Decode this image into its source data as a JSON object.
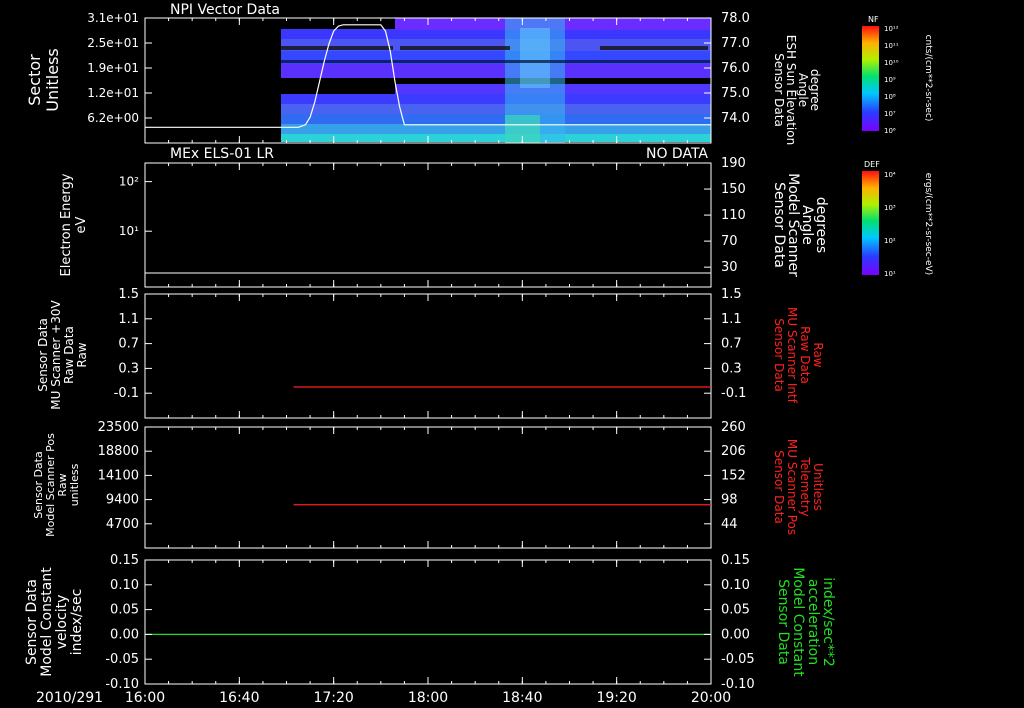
{
  "colors": {
    "background": "#000000",
    "axes": "#ffffff",
    "red_trace": "#ff2020",
    "green_trace": "#22dd22"
  },
  "chart_data": [
    {
      "type": "heatmap",
      "title": "NPI Vector Data",
      "ylabel": [
        "Sector",
        "Unitless"
      ],
      "yticks": [
        "3.1e+01",
        "2.5e+01",
        "1.9e+01",
        "1.2e+01",
        "6.2e+00"
      ],
      "y2label": [
        "Sensor Data",
        "ESH Sun Elevation",
        "Angle",
        "degree"
      ],
      "y2ticks": [
        "78.0",
        "77.0",
        "76.0",
        "75.0",
        "74.0"
      ],
      "y2lim": [
        73.3,
        78.0
      ],
      "overlay_line": {
        "x_minutes": [
          0,
          65,
          68,
          70,
          72,
          74,
          76,
          78,
          80,
          82,
          84,
          100,
          102,
          104,
          106,
          108,
          110,
          240
        ],
        "y": [
          73.8,
          73.8,
          73.9,
          74.2,
          74.8,
          75.6,
          76.4,
          77.1,
          77.6,
          77.8,
          77.85,
          77.85,
          77.6,
          76.8,
          75.6,
          74.6,
          73.9,
          73.9
        ]
      },
      "colorbar": {
        "label": "NF",
        "unit": "cnts/(cm**2-sr-sec)",
        "ticks": [
          "10¹²",
          "10¹¹",
          "10¹⁰",
          "10⁹",
          "10⁸",
          "10⁷",
          "10⁶"
        ]
      }
    },
    {
      "type": "line",
      "title": "MEx ELS-01 LR",
      "status": "NO DATA",
      "ylabel": [
        "Electron Energy",
        "eV"
      ],
      "yticks": [
        "10²",
        "10¹"
      ],
      "y2label": [
        "Sensor Data",
        "Model Scanner",
        "Angle",
        "degrees"
      ],
      "y2ticks": [
        "190",
        "150",
        "110",
        "70",
        "30"
      ],
      "y2lim": [
        0,
        190
      ],
      "series": [
        {
          "x_minutes": [
            0,
            240
          ],
          "y": [
            10,
            10
          ]
        }
      ],
      "colorbar": {
        "label": "DEF",
        "unit": "ergs/(cm**2-sr-sec-eV)",
        "ticks": [
          "10⁴",
          "10³",
          "10²",
          "10¹"
        ]
      }
    },
    {
      "type": "line",
      "ylabel": [
        "Sensor Data",
        "MU Scanner +30V",
        "Raw Data",
        "Raw"
      ],
      "yticks": [
        "1.5",
        "1.1",
        "0.7",
        "0.3",
        "-0.1"
      ],
      "ylim": [
        -0.5,
        1.5
      ],
      "y2label": [
        "Sensor Data",
        "MU Scanner Intf",
        "Raw Data",
        "Raw"
      ],
      "y2ticks": [
        "1.5",
        "1.1",
        "0.7",
        "0.3",
        "-0.1"
      ],
      "series": [
        {
          "x_minutes": [
            63,
            240
          ],
          "y": [
            0.0,
            0.0
          ]
        }
      ]
    },
    {
      "type": "line",
      "ylabel": [
        "Sensor Data",
        "Model Scanner Pos",
        "Raw",
        "unitless"
      ],
      "yticks": [
        "23500",
        "18800",
        "14100",
        "9400",
        "4700"
      ],
      "ylim": [
        0,
        23500
      ],
      "y2label": [
        "Sensor Data",
        "MU Scanner Pos",
        "Telemetry",
        "Unitless"
      ],
      "y2ticks": [
        "260",
        "206",
        "152",
        "98",
        "44"
      ],
      "series": [
        {
          "x_minutes": [
            63,
            240
          ],
          "y": [
            8400,
            8400
          ]
        }
      ]
    },
    {
      "type": "line",
      "ylabel": [
        "Sensor Data",
        "Model Constant",
        "velocity",
        "index/sec"
      ],
      "yticks": [
        "0.15",
        "0.10",
        "0.05",
        "0.00",
        "-0.05",
        "-0.10"
      ],
      "ylim": [
        -0.1,
        0.15
      ],
      "y2label": [
        "Sensor Data",
        "Model Constant",
        "acceleration",
        "index/sec**2"
      ],
      "y2ticks": [
        "0.15",
        "0.10",
        "0.05",
        "0.00",
        "-0.05",
        "-0.10"
      ],
      "series": [
        {
          "x_minutes": [
            0,
            240
          ],
          "y": [
            0.0,
            0.0
          ]
        }
      ]
    }
  ],
  "time_axis": {
    "date": "2010/291",
    "ticks": [
      "16:00",
      "16:40",
      "17:20",
      "18:00",
      "18:40",
      "19:20",
      "20:00"
    ],
    "range_minutes": [
      0,
      240
    ]
  }
}
